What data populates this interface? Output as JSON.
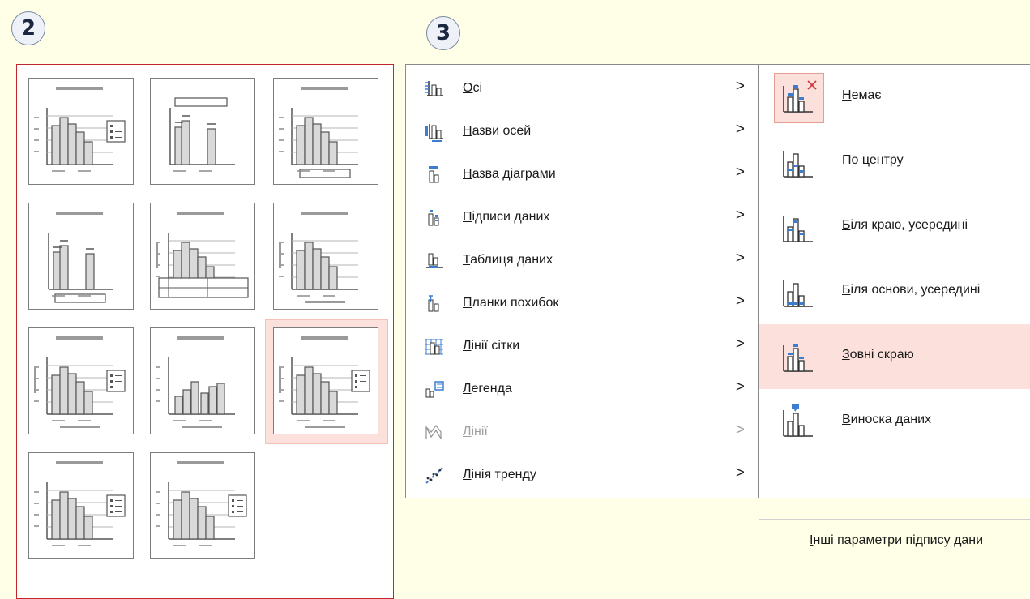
{
  "badges": {
    "step2": "2",
    "step3": "3"
  },
  "menu": {
    "items": [
      {
        "label": "Осі",
        "accel": "О",
        "rest": "сі",
        "icon": "axes-icon",
        "disabled": false
      },
      {
        "label": "Назви осей",
        "accel": "Н",
        "rest": "азви осей",
        "icon": "axis-titles-icon",
        "disabled": false
      },
      {
        "label": "Назва діаграми",
        "accel": "Н",
        "rest": "азва діаграми",
        "icon": "chart-title-icon",
        "disabled": false
      },
      {
        "label": "Підписи даних",
        "accel": "П",
        "rest": "ідписи даних",
        "icon": "data-labels-icon",
        "disabled": false
      },
      {
        "label": "Таблиця даних",
        "accel": "Т",
        "rest": "аблиця даних",
        "icon": "data-table-icon",
        "disabled": false
      },
      {
        "label": "Планки похибок",
        "accel": "П",
        "rest": "ланки похибок",
        "icon": "error-bars-icon",
        "disabled": false
      },
      {
        "label": "Лінії сітки",
        "accel": "Л",
        "rest": "інії сітки",
        "icon": "gridlines-icon",
        "disabled": false
      },
      {
        "label": "Легенда",
        "accel": "Л",
        "rest": "егенда",
        "icon": "legend-icon",
        "disabled": false
      },
      {
        "label": "Лінії",
        "accel": "Л",
        "rest": "інії",
        "icon": "lines-icon",
        "disabled": true
      },
      {
        "label": "Лінія тренду",
        "accel": "Л",
        "rest": "інія тренду",
        "icon": "trendline-icon",
        "disabled": false
      }
    ],
    "chevron": ">"
  },
  "submenu": {
    "items": [
      {
        "label": "Немає",
        "accel": "Н",
        "rest": "емає",
        "icon": "no-labels-icon",
        "state": "checked"
      },
      {
        "label": "По центру",
        "accel": "П",
        "rest": "о центру",
        "icon": "labels-center-icon",
        "state": ""
      },
      {
        "label": "Біля краю, усередині",
        "accel": "Б",
        "rest": "іля краю, усередині",
        "icon": "labels-inside-end-icon",
        "state": ""
      },
      {
        "label": "Біля основи, усередині",
        "accel": "Б",
        "rest": "іля основи, усередині",
        "icon": "labels-inside-base-icon",
        "state": ""
      },
      {
        "label": "Зовні скраю",
        "accel": "З",
        "rest": "овні скраю",
        "icon": "labels-outside-end-icon",
        "state": "hover"
      },
      {
        "label": "Виноска даних",
        "accel": "В",
        "rest": "иноска даних",
        "icon": "data-callout-icon",
        "state": ""
      }
    ],
    "more": {
      "accel": "І",
      "rest": "нші параметри підпису дани"
    }
  },
  "layouts": {
    "count": 11,
    "selected_index": 8,
    "colors": {
      "highlight": "#fbe0dc",
      "panel_border": "#c0272d",
      "bar_fill": "#d9d9d9"
    }
  }
}
